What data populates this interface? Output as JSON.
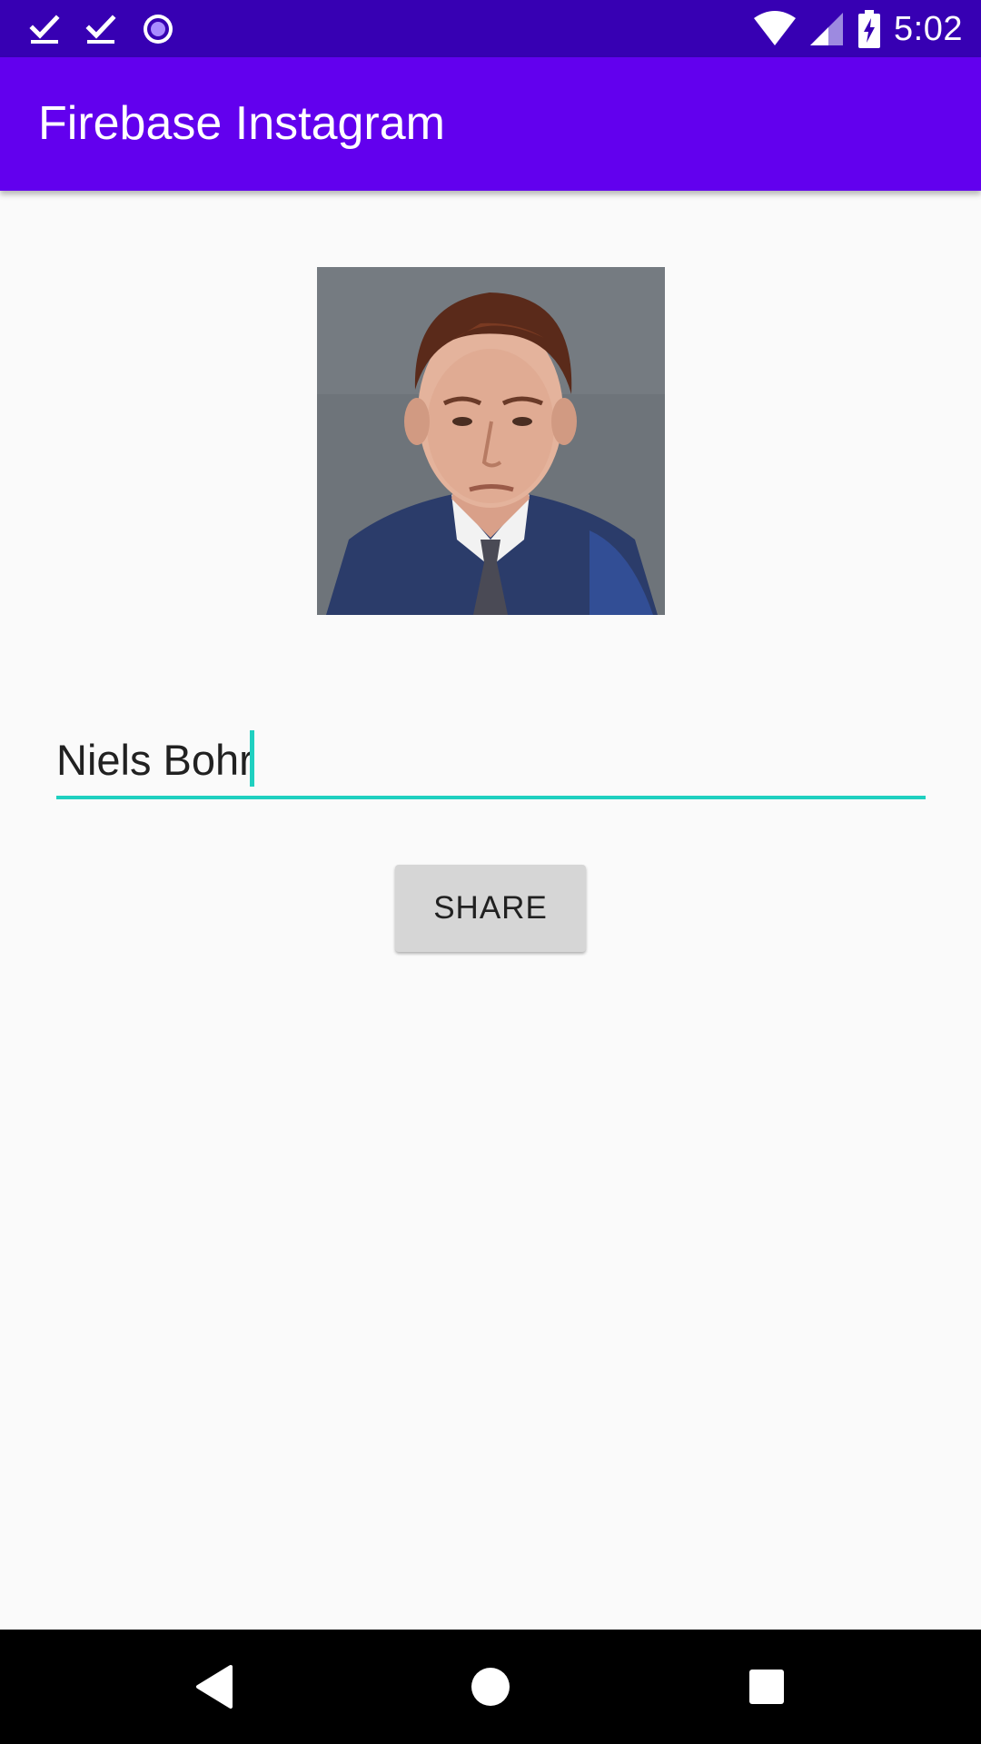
{
  "status_bar": {
    "time": "5:02",
    "left_icons": [
      "download-done-icon",
      "download-done-icon",
      "sync-circle-icon"
    ],
    "right_icons": [
      "wifi-icon",
      "cell-signal-icon",
      "battery-charging-icon"
    ],
    "background": "#3700b3"
  },
  "app_bar": {
    "title": "Firebase Instagram",
    "background": "#6200ee"
  },
  "main": {
    "photo_icon": "portrait-photo",
    "caption": {
      "value": "Niels Bohr",
      "accent": "#1fd0c0"
    },
    "share_label": "SHARE"
  },
  "nav_bar": {
    "items": [
      "back-icon",
      "home-icon",
      "recents-icon"
    ]
  }
}
